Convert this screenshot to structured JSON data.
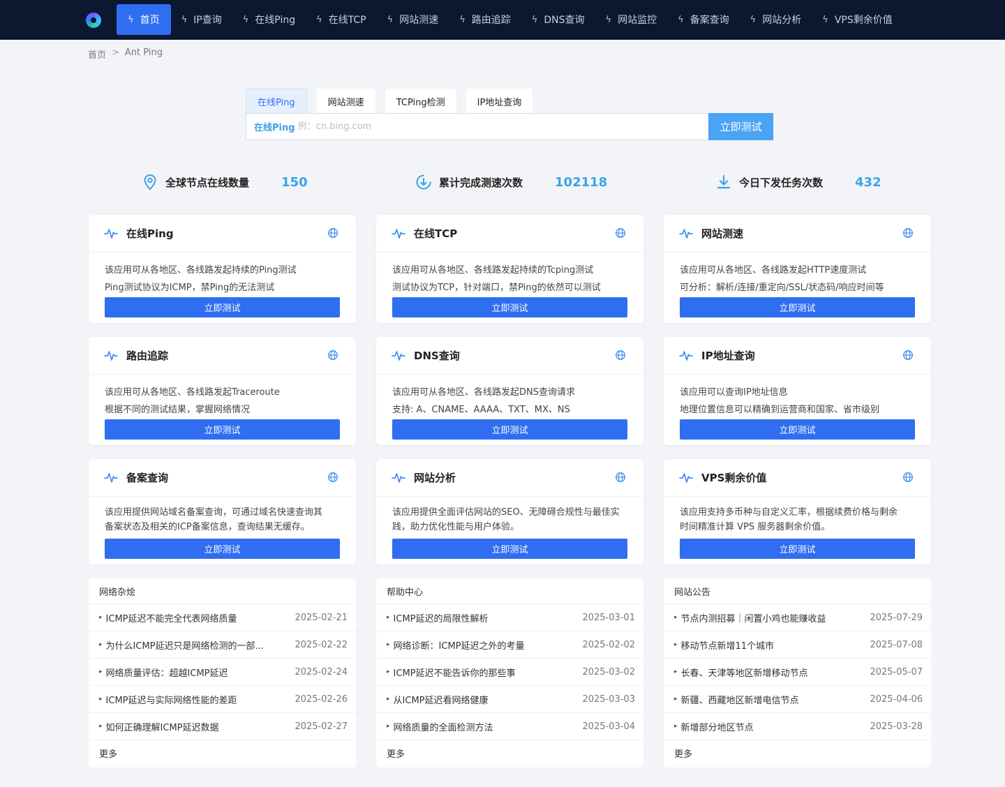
{
  "nav": {
    "items": [
      {
        "label": "首页",
        "active": true,
        "name": "nav-home"
      },
      {
        "label": "IP查询",
        "name": "nav-ip"
      },
      {
        "label": "在线Ping",
        "name": "nav-ping"
      },
      {
        "label": "在线TCP",
        "name": "nav-tcp"
      },
      {
        "label": "网站测速",
        "name": "nav-speed"
      },
      {
        "label": "路由追踪",
        "name": "nav-trace"
      },
      {
        "label": "DNS查询",
        "name": "nav-dns"
      },
      {
        "label": "网站监控",
        "name": "nav-monitor"
      },
      {
        "label": "备案查询",
        "name": "nav-icp"
      },
      {
        "label": "网站分析",
        "name": "nav-analysis"
      },
      {
        "label": "VPS剩余价值",
        "name": "nav-vps"
      }
    ]
  },
  "breadcrumb": {
    "home": "首页",
    "sep": ">",
    "current": "Ant Ping"
  },
  "search": {
    "tabs": [
      "在线Ping",
      "网站测速",
      "TCPing检测",
      "IP地址查询"
    ],
    "prefix": "在线Ping",
    "placeholder": "例：cn.bing.com",
    "button": "立即测试"
  },
  "stats": [
    {
      "label": "全球节点在线数量",
      "value": "150",
      "icon": "location-pin-icon"
    },
    {
      "label": "累计完成测速次数",
      "value": "102118",
      "icon": "download-circle-icon"
    },
    {
      "label": "今日下发任务次数",
      "value": "432",
      "icon": "download-arrow-icon"
    }
  ],
  "cards": [
    {
      "title": "在线Ping",
      "lines": [
        "该应用可从各地区、各线路发起持续的Ping测试",
        "Ping测试协议为ICMP，禁Ping的无法测试"
      ],
      "button": "立即测试"
    },
    {
      "title": "在线TCP",
      "lines": [
        "该应用可从各地区、各线路发起持续的Tcping测试",
        "测试协议为TCP，针对端口，禁Ping的依然可以测试"
      ],
      "button": "立即测试"
    },
    {
      "title": "网站测速",
      "lines": [
        "该应用可从各地区、各线路发起HTTP速度测试",
        "可分析：解析/连接/重定向/SSL/状态码/响应时间等"
      ],
      "button": "立即测试"
    },
    {
      "title": "路由追踪",
      "lines": [
        "该应用可从各地区、各线路发起Traceroute",
        "根据不同的测试结果，掌握网络情况"
      ],
      "button": "立即测试"
    },
    {
      "title": "DNS查询",
      "lines": [
        "该应用可从各地区、各线路发起DNS查询请求",
        "支持: A、CNAME、AAAA、TXT、MX、NS"
      ],
      "button": "立即测试"
    },
    {
      "title": "IP地址查询",
      "lines": [
        "该应用可以查询IP地址信息",
        "地理位置信息可以精确到运营商和国家、省市级别"
      ],
      "button": "立即测试"
    },
    {
      "title": "备案查询",
      "lines": [
        "该应用提供网站域名备案查询，可通过域名快速查询其",
        "备案状态及相关的ICP备案信息，查询结果无缓存。"
      ],
      "button": "立即测试"
    },
    {
      "title": "网站分析",
      "lines": [
        "该应用提供全面评估网站的SEO、无障碍合规性与最佳实",
        "践，助力优化性能与用户体验。"
      ],
      "button": "立即测试"
    },
    {
      "title": "VPS剩余价值",
      "lines": [
        "该应用支持多币种与自定义汇率，根据续费价格与剩余",
        "时间精准计算 VPS 服务器剩余价值。"
      ],
      "button": "立即测试"
    }
  ],
  "lists": [
    {
      "title": "网络杂烩",
      "items": [
        {
          "title": "ICMP延迟不能完全代表网络质量",
          "date": "2025-02-21"
        },
        {
          "title": "为什么ICMP延迟只是网络检测的一部...",
          "date": "2025-02-22"
        },
        {
          "title": "网络质量评估：超越ICMP延迟",
          "date": "2025-02-24"
        },
        {
          "title": "ICMP延迟与实际网络性能的差距",
          "date": "2025-02-26"
        },
        {
          "title": "如何正确理解ICMP延迟数据",
          "date": "2025-02-27"
        }
      ],
      "more": "更多"
    },
    {
      "title": "帮助中心",
      "items": [
        {
          "title": "ICMP延迟的局限性解析",
          "date": "2025-03-01"
        },
        {
          "title": "网络诊断：ICMP延迟之外的考量",
          "date": "2025-02-02"
        },
        {
          "title": "ICMP延迟不能告诉你的那些事",
          "date": "2025-03-02"
        },
        {
          "title": "从ICMP延迟看网络健康",
          "date": "2025-03-03"
        },
        {
          "title": "网络质量的全面检测方法",
          "date": "2025-03-04"
        }
      ],
      "more": "更多"
    },
    {
      "title": "网站公告",
      "items": [
        {
          "title": "节点内测招募｜闲置小鸡也能赚收益",
          "date": "2025-07-29"
        },
        {
          "title": "移动节点新增11个城市",
          "date": "2025-07-08"
        },
        {
          "title": "长春、天津等地区新增移动节点",
          "date": "2025-05-07"
        },
        {
          "title": "新疆、西藏地区新增电信节点",
          "date": "2025-04-06"
        },
        {
          "title": "新增部分地区节点",
          "date": "2025-03-28"
        }
      ],
      "more": "更多"
    }
  ],
  "colors": {
    "nav_bg": "#0c1830",
    "primary": "#2f6ef0",
    "accent": "#3ba3e8",
    "page_bg": "#f2f4f7"
  }
}
